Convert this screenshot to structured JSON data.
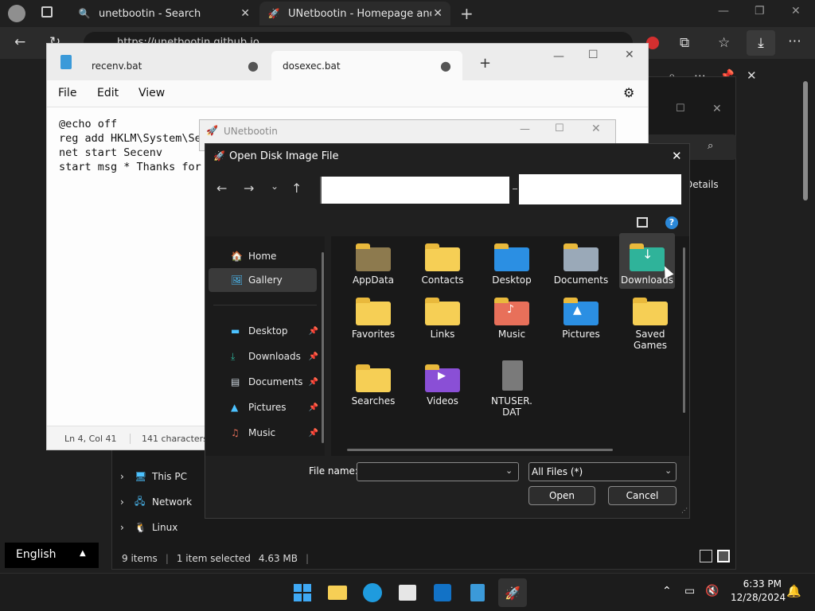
{
  "browser": {
    "tabs": [
      {
        "label": "unetbootin - Search"
      },
      {
        "label": "UNetbootin - Homepage and Do"
      }
    ],
    "address": "https://unetbootin.github.io"
  },
  "notepad": {
    "tabs": [
      {
        "label": "recenv.bat"
      },
      {
        "label": "dosexec.bat"
      }
    ],
    "menu": {
      "file": "File",
      "edit": "Edit",
      "view": "View"
    },
    "text": "@echo off\nreg add HKLM\\System\\Se\nnet start Secenv\nstart msg * Thanks for",
    "status": {
      "position": "Ln 4, Col 41",
      "chars": "141 characters"
    }
  },
  "unetbootin": {
    "title": "UNetbootin"
  },
  "explorer_bg": {
    "details_label": "Details",
    "nav": [
      {
        "label": "This PC"
      },
      {
        "label": "Network"
      },
      {
        "label": "Linux"
      }
    ],
    "status": {
      "items": "9 items",
      "selected": "1 item selected",
      "size": "4.63 MB"
    }
  },
  "dialog": {
    "title": "Open Disk Image File",
    "sidebar": [
      {
        "label": "Home"
      },
      {
        "label": "Gallery"
      },
      {
        "label": "Desktop"
      },
      {
        "label": "Downloads"
      },
      {
        "label": "Documents"
      },
      {
        "label": "Pictures"
      },
      {
        "label": "Music"
      }
    ],
    "items": [
      {
        "label": "AppData"
      },
      {
        "label": "Contacts"
      },
      {
        "label": "Desktop"
      },
      {
        "label": "Documents"
      },
      {
        "label": "Downloads"
      },
      {
        "label": "Favorites"
      },
      {
        "label": "Links"
      },
      {
        "label": "Music"
      },
      {
        "label": "Pictures"
      },
      {
        "label": "Saved Games"
      },
      {
        "label": "Searches"
      },
      {
        "label": "Videos"
      },
      {
        "label": "NTUSER.DAT"
      }
    ],
    "filename_label": "File name:",
    "filename_value": "",
    "filter": "All Files (*)",
    "open_label": "Open",
    "cancel_label": "Cancel"
  },
  "taskbar": {
    "language": "English",
    "time": "6:33 PM",
    "date": "12/28/2024"
  },
  "colors": {
    "accent": "#4cc2ff",
    "folder": "#f6cf55",
    "downloads_folder": "#2fb39a"
  }
}
